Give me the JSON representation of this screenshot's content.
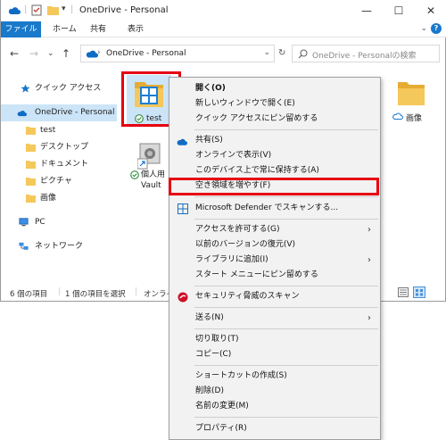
{
  "window": {
    "title": "OneDrive - Personal",
    "minimize": "—",
    "maximize": "☐",
    "close": "✕"
  },
  "ribbon": {
    "tabs": [
      "ファイル",
      "ホーム",
      "共有",
      "表示"
    ],
    "help": "?"
  },
  "address": {
    "path": "OneDrive - Personal",
    "search_placeholder": "OneDrive - Personalの検索"
  },
  "sidebar": {
    "items": [
      {
        "label": "クイック アクセス"
      },
      {
        "label": "OneDrive - Personal"
      },
      {
        "label": "test"
      },
      {
        "label": "デスクトップ"
      },
      {
        "label": "ドキュメント"
      },
      {
        "label": "ピクチャ"
      },
      {
        "label": "画像"
      },
      {
        "label": "PC"
      },
      {
        "label": "ネットワーク"
      }
    ]
  },
  "content": {
    "items": [
      {
        "label": "test"
      },
      {
        "label": "個人用\nVault"
      },
      {
        "label": "画像"
      }
    ]
  },
  "status": {
    "count": "6 個の項目",
    "selected": "1 個の項目を選択",
    "online": "オンライ"
  },
  "menu": {
    "items": [
      {
        "label": "開く(O)"
      },
      {
        "label": "新しいウィンドウで開く(E)"
      },
      {
        "label": "クイック アクセスにピン留めする"
      },
      {
        "label": "共有(S)"
      },
      {
        "label": "オンラインで表示(V)"
      },
      {
        "label": "このデバイス上で常に保持する(A)"
      },
      {
        "label": "空き領域を増やす(F)"
      },
      {
        "label": "Microsoft Defender でスキャンする..."
      },
      {
        "label": "アクセスを許可する(G)"
      },
      {
        "label": "以前のバージョンの復元(V)"
      },
      {
        "label": "ライブラリに追加(I)"
      },
      {
        "label": "スタート メニューにピン留めする"
      },
      {
        "label": "セキュリティ脅威のスキャン"
      },
      {
        "label": "送る(N)"
      },
      {
        "label": "切り取り(T)"
      },
      {
        "label": "コピー(C)"
      },
      {
        "label": "ショートカットの作成(S)"
      },
      {
        "label": "削除(D)"
      },
      {
        "label": "名前の変更(M)"
      },
      {
        "label": "プロパティ(R)"
      }
    ]
  },
  "colors": {
    "accent": "#1979ca",
    "highlight": "#e60012",
    "folder": "#f5c85b",
    "selection": "#cce4f7"
  }
}
